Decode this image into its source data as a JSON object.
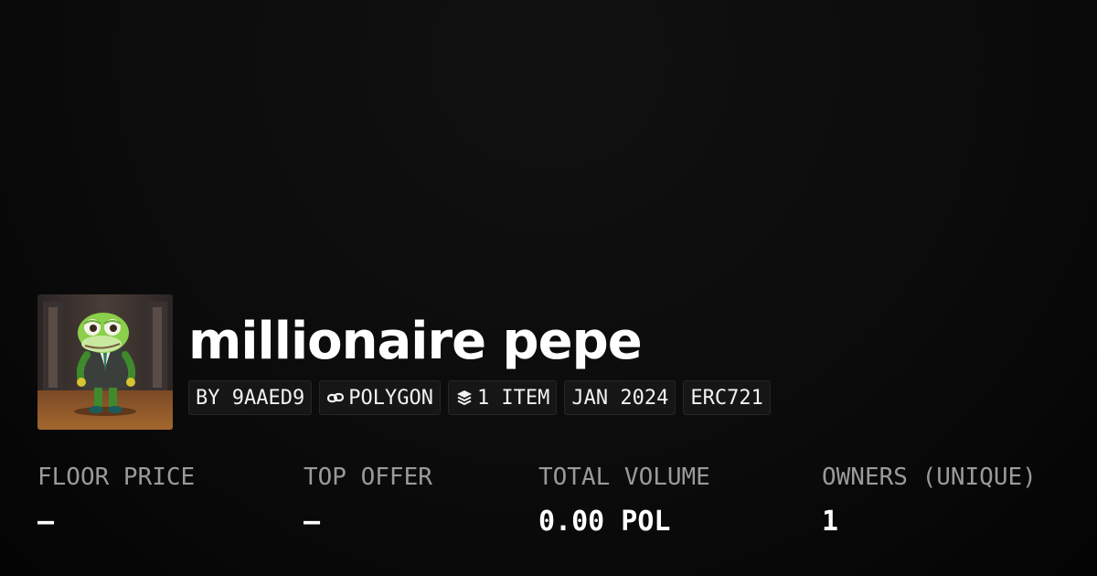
{
  "collection": {
    "name": "millionaire pepe",
    "avatar_icon": "pepe-in-suit-avatar"
  },
  "badges": {
    "creator": "BY 9AAED9",
    "chain": "POLYGON",
    "chain_icon": "polygon-link-icon",
    "items": "1 ITEM",
    "items_icon": "layers-icon",
    "date": "JAN 2024",
    "standard": "ERC721"
  },
  "stats": [
    {
      "label": "FLOOR PRICE",
      "value": "–"
    },
    {
      "label": "TOP OFFER",
      "value": "–"
    },
    {
      "label": "TOTAL VOLUME",
      "value": "0.00 POL"
    },
    {
      "label": "OWNERS (UNIQUE)",
      "value": "1"
    }
  ],
  "colors": {
    "background": "#0b0b0b",
    "badge_bg": "#161616",
    "label_gray": "#9a9a9a",
    "text": "#ffffff"
  }
}
